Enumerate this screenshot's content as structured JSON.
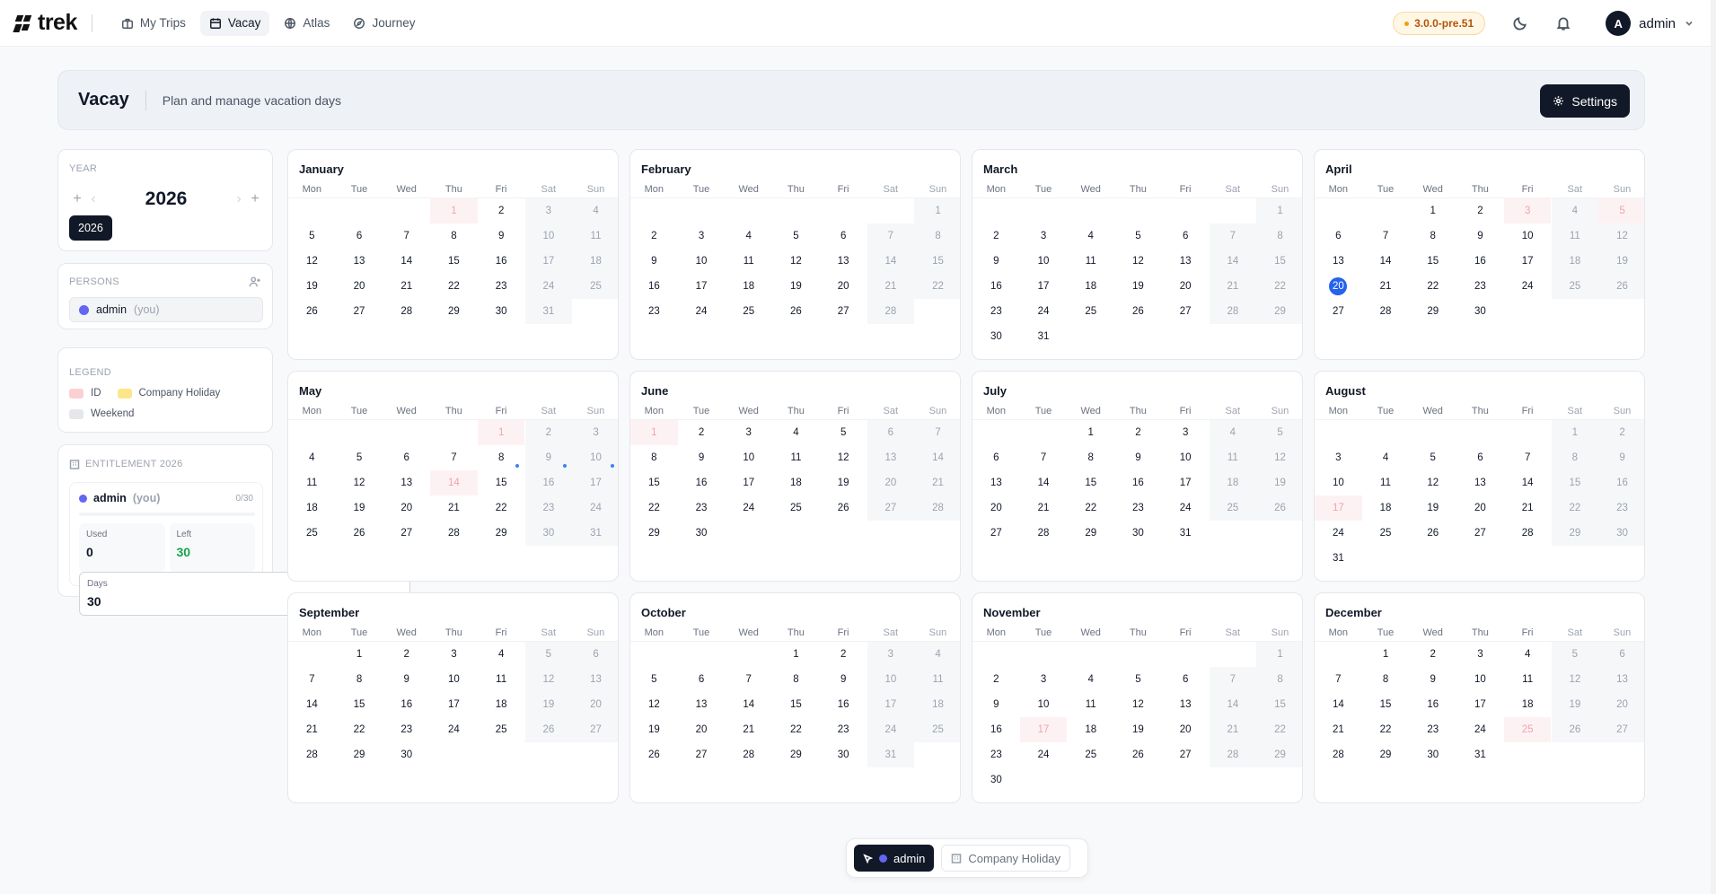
{
  "app": {
    "logo_text": "trek",
    "nav": [
      {
        "label": "My Trips",
        "icon": "suitcase-icon"
      },
      {
        "label": "Vacay",
        "icon": "calendar-icon"
      },
      {
        "label": "Atlas",
        "icon": "globe-icon"
      },
      {
        "label": "Journey",
        "icon": "compass-icon"
      }
    ],
    "active_nav": "Vacay",
    "version": "3.0.0-pre.51",
    "user": {
      "initial": "A",
      "name": "admin"
    }
  },
  "header": {
    "title": "Vacay",
    "subtitle": "Plan and manage vacation days",
    "settings_label": "Settings"
  },
  "sidebar": {
    "year_label": "YEAR",
    "year": "2026",
    "year_chip": "2026",
    "persons_label": "PERSONS",
    "person": {
      "name": "admin",
      "suffix": "(you)",
      "color": "#6366f1"
    },
    "legend_label": "LEGEND",
    "legend": [
      {
        "label": "ID",
        "color": "#fbd0d3"
      },
      {
        "label": "Company Holiday",
        "color": "#fde68a"
      },
      {
        "label": "Weekend",
        "color": "#e5e7eb"
      }
    ],
    "entitlement_label": "ENTITLEMENT 2026",
    "entitlement": {
      "name": "admin",
      "suffix": "(you)",
      "ratio": "0/30",
      "used_fraction": 0,
      "days_label": "Days",
      "days": "30",
      "used_label": "Used",
      "used": "0",
      "left_label": "Left",
      "left": "30"
    }
  },
  "calendar": {
    "weekdays": [
      "Mon",
      "Tue",
      "Wed",
      "Thu",
      "Fri",
      "Sat",
      "Sun"
    ],
    "months": [
      {
        "name": "January",
        "offset": 3,
        "days": 31,
        "holidays": [
          1
        ]
      },
      {
        "name": "February",
        "offset": 6,
        "days": 28,
        "holidays": []
      },
      {
        "name": "March",
        "offset": 6,
        "days": 31,
        "holidays": []
      },
      {
        "name": "April",
        "offset": 2,
        "days": 30,
        "holidays": [
          3,
          5
        ],
        "today": 20
      },
      {
        "name": "May",
        "offset": 4,
        "days": 31,
        "holidays": [
          1,
          14
        ]
      },
      {
        "name": "June",
        "offset": 0,
        "days": 30,
        "holidays": [
          1
        ]
      },
      {
        "name": "July",
        "offset": 2,
        "days": 31,
        "holidays": []
      },
      {
        "name": "August",
        "offset": 5,
        "days": 31,
        "holidays": [
          17
        ]
      },
      {
        "name": "September",
        "offset": 1,
        "days": 30,
        "holidays": []
      },
      {
        "name": "October",
        "offset": 3,
        "days": 31,
        "holidays": []
      },
      {
        "name": "November",
        "offset": 6,
        "days": 30,
        "holidays": [
          17
        ]
      },
      {
        "name": "December",
        "offset": 1,
        "days": 31,
        "holidays": [
          25
        ]
      }
    ]
  },
  "bottom_bar": {
    "person_label": "admin",
    "holiday_label": "Company Holiday"
  }
}
